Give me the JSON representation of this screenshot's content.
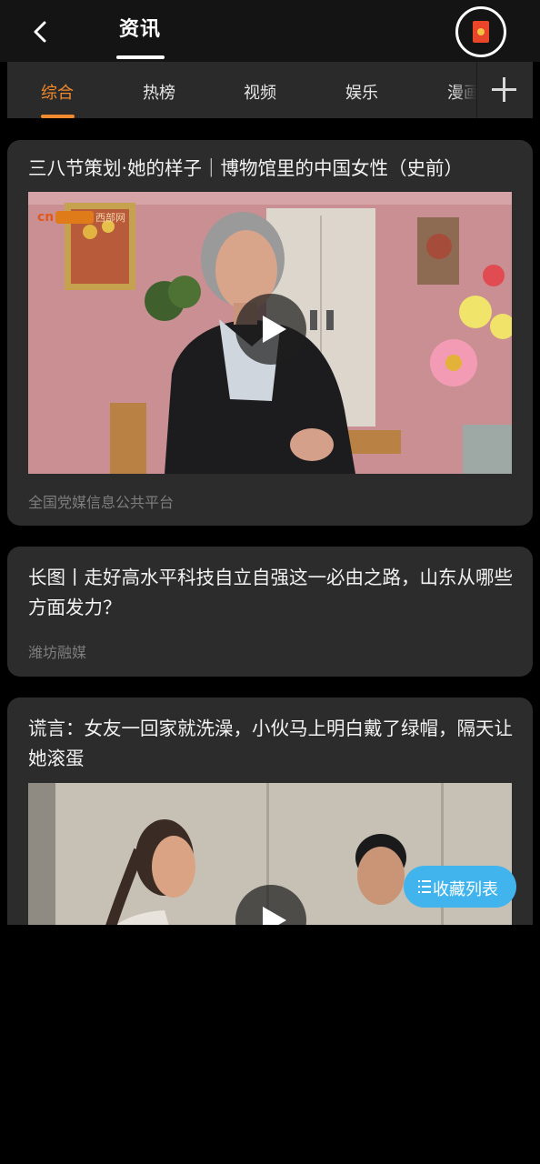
{
  "header": {
    "title": "资讯"
  },
  "tabs": [
    {
      "label": "综合",
      "active": true
    },
    {
      "label": "热榜",
      "active": false
    },
    {
      "label": "视频",
      "active": false
    },
    {
      "label": "娱乐",
      "active": false
    },
    {
      "label": "漫画",
      "active": false
    }
  ],
  "colors": {
    "accent": "#f08a2c",
    "card_background": "#2c2c2c",
    "fab": "#41b4ee"
  },
  "cards": [
    {
      "title": "三八节策划·她的样子｜博物馆里的中国女性（史前）",
      "source": "全国党媒信息公共平台",
      "thumb_watermark": "cn 西部网",
      "has_video": true
    },
    {
      "title": "长图丨走好高水平科技自立自强这一必由之路，山东从哪些方面发力？",
      "source": "潍坊融媒",
      "has_video": false
    },
    {
      "title": "谎言：女友一回家就洗澡，小伙马上明白戴了绿帽，隔天让她滚蛋",
      "has_video": true
    }
  ],
  "fab": {
    "label": "收藏列表",
    "icon": "list-icon"
  },
  "icons": {
    "back": "back-arrow-icon",
    "redpacket": "red-packet-icon",
    "add": "plus-icon",
    "play": "play-icon"
  }
}
